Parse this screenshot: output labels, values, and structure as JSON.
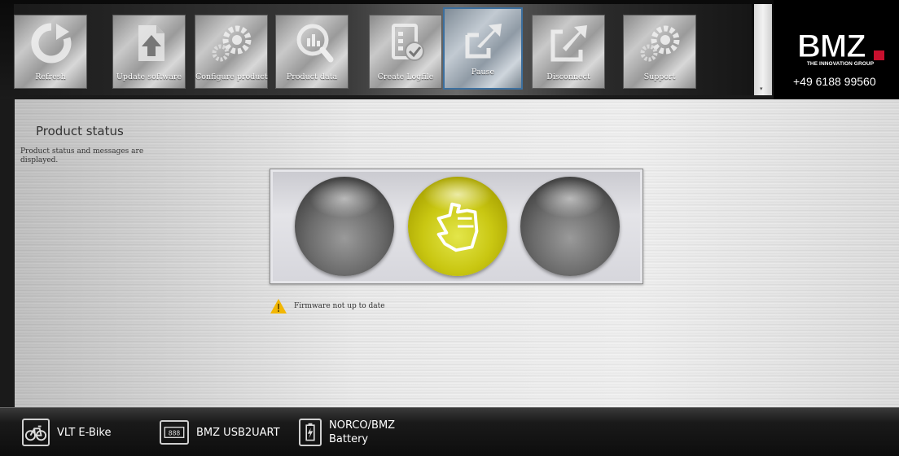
{
  "toolbar": {
    "buttons": [
      {
        "label": "Refresh",
        "icon": "refresh-icon"
      },
      {
        "label": "Update software",
        "icon": "document-upload-icon"
      },
      {
        "label": "Configure product",
        "icon": "gears-icon"
      },
      {
        "label": "Product data",
        "icon": "magnifier-chart-icon"
      },
      {
        "label": "Create Logfile",
        "icon": "logfile-icon"
      },
      {
        "label": "Pause",
        "icon": "pause-arrow-icon"
      },
      {
        "label": "Disconnect",
        "icon": "disconnect-icon"
      },
      {
        "label": "Support",
        "icon": "gears-icon"
      }
    ],
    "active": "Pause"
  },
  "brand": {
    "logo_text": "BMZ",
    "tagline": "THE INNOVATION GROUP",
    "phone": "+49 6188 99560"
  },
  "main": {
    "title": "Product status",
    "description": "Product status and messages are displayed.",
    "traffic_light": {
      "left": "off",
      "middle": "on",
      "right": "off",
      "middle_icon": "hand-stop-icon",
      "on_color": "#c9c712"
    },
    "message": {
      "text": "Firmware not up to date",
      "icon": "warning-icon",
      "color": "#f2b705"
    }
  },
  "bottombar": {
    "devices": [
      {
        "label": "VLT E-Bike",
        "icon": "bicycle-icon"
      },
      {
        "label": "BMZ USB2UART",
        "icon": "display-888-icon"
      },
      {
        "label": "NORCO/BMZ Battery",
        "line1": "NORCO/BMZ",
        "line2": "Battery",
        "icon": "battery-icon"
      }
    ]
  },
  "colors": {
    "active_border": "#3c6f9e",
    "logo_red": "#c8102e"
  }
}
